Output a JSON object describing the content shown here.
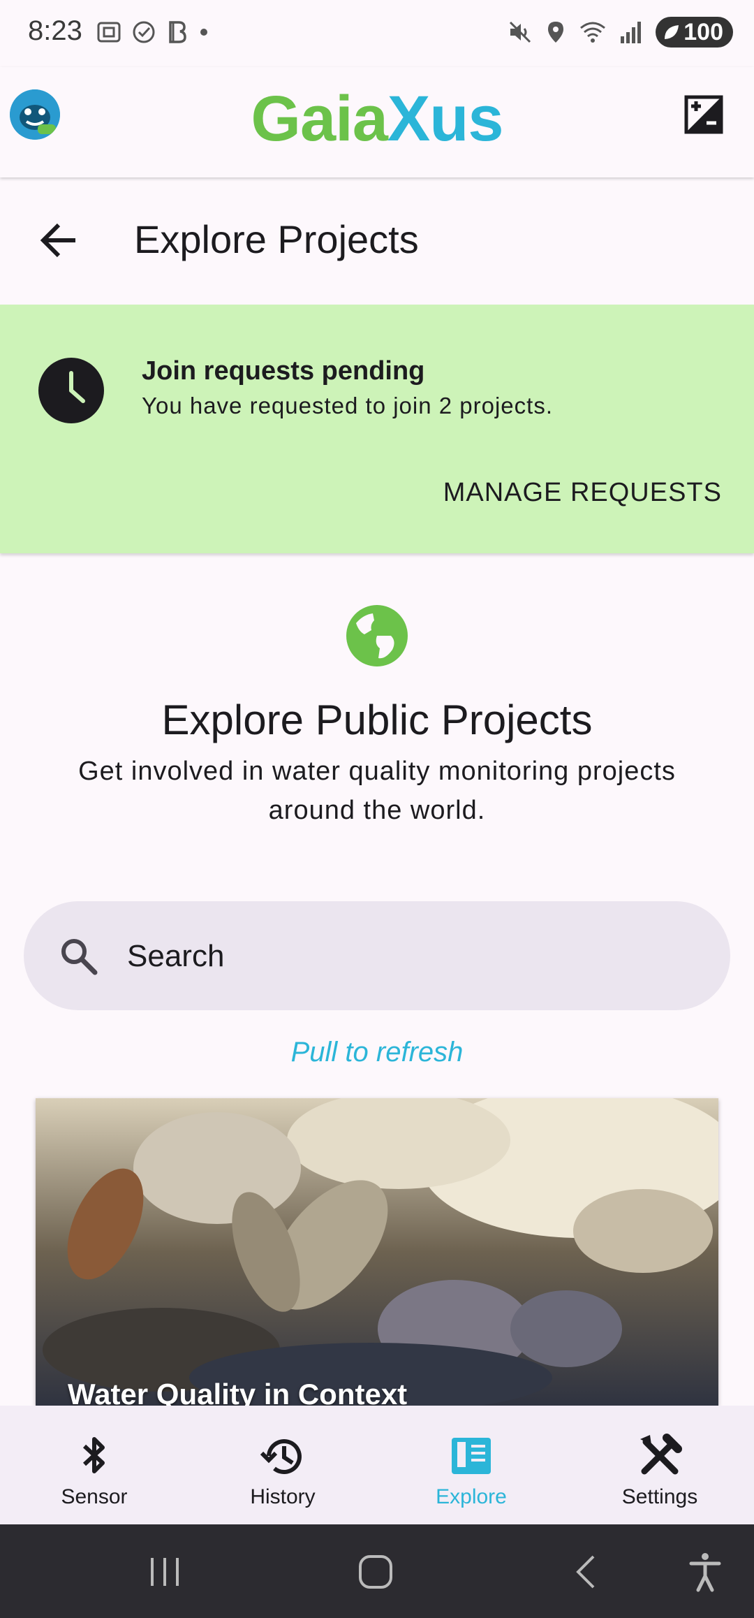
{
  "status_bar": {
    "time": "8:23",
    "battery": "100",
    "left_icons": [
      "screenshot-icon",
      "check-circle-icon",
      "b-app-icon",
      "dot-icon"
    ],
    "right_icons": [
      "mute-icon",
      "location-icon",
      "wifi-icon",
      "signal-icon",
      "battery-icon"
    ]
  },
  "app_bar": {
    "title_part1": "Gaia",
    "title_part2": "Xus",
    "avatar_icon": "gaiaxus-logo-icon",
    "action_icon": "exposure-icon"
  },
  "page_header": {
    "title": "Explore Projects",
    "back_icon": "arrow-back-icon"
  },
  "banner": {
    "title": "Join requests pending",
    "text": "You have requested to join 2 projects.",
    "button": "MANAGE REQUESTS",
    "icon": "clock-icon",
    "color": "#cdf3b8"
  },
  "explore": {
    "icon": "globe-icon",
    "title": "Explore Public Projects",
    "subtitle": "Get involved in water quality monitoring projects around the world."
  },
  "search": {
    "placeholder": "Search",
    "icon": "search-icon"
  },
  "pull_to_refresh": "Pull to refresh",
  "projects": [
    {
      "name": "Water Quality in Context"
    }
  ],
  "bottom_nav": {
    "items": [
      {
        "label": "Sensor",
        "icon": "bluetooth-icon"
      },
      {
        "label": "History",
        "icon": "history-icon"
      },
      {
        "label": "Explore",
        "icon": "explore-book-icon",
        "active": true
      },
      {
        "label": "Settings",
        "icon": "tools-icon"
      }
    ]
  },
  "colors": {
    "brand_green": "#6cc24a",
    "brand_cyan": "#2bb5d8",
    "banner_green": "#cdf3b8"
  }
}
